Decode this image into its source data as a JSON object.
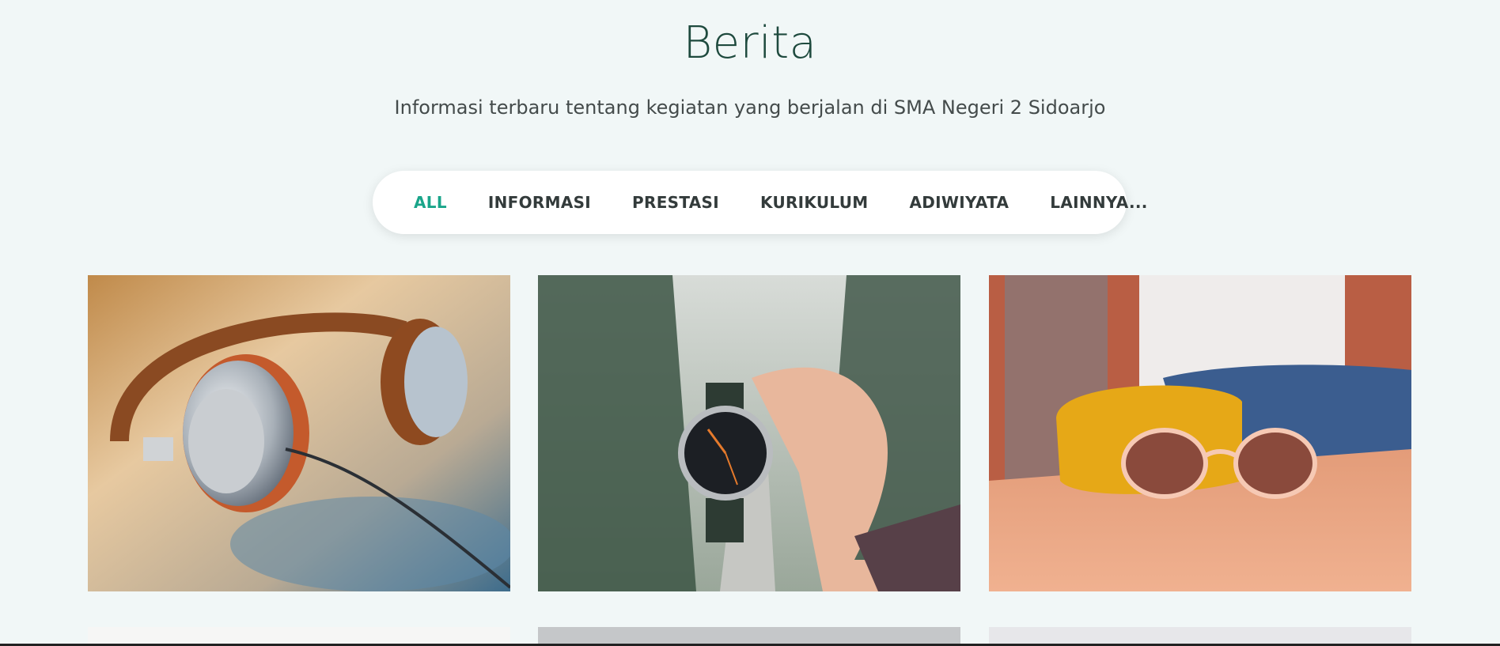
{
  "header": {
    "title": "Berita",
    "subtitle": "Informasi terbaru tentang kegiatan yang berjalan di SMA Negeri 2 Sidoarjo"
  },
  "filters": {
    "items": [
      {
        "label": "ALL",
        "active": true
      },
      {
        "label": "INFORMASI",
        "active": false
      },
      {
        "label": "PRESTASI",
        "active": false
      },
      {
        "label": "KURIKULUM",
        "active": false
      },
      {
        "label": "ADIWIYATA",
        "active": false
      },
      {
        "label": "LAINNYA...",
        "active": false
      }
    ]
  },
  "gallery": {
    "items": [
      {
        "image": "headphones-photo"
      },
      {
        "image": "wristwatch-photo"
      },
      {
        "image": "sunglasses-photo"
      }
    ]
  },
  "colors": {
    "background": "#f1f7f7",
    "accent": "#1aa58a",
    "title": "#1e4a3e"
  }
}
